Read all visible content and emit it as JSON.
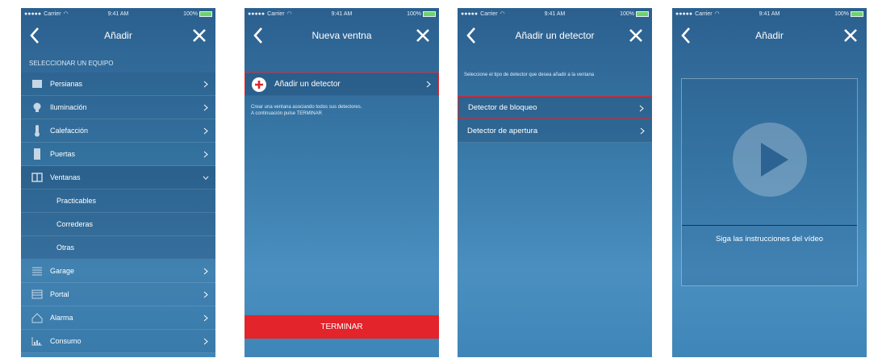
{
  "status": {
    "carrier": "Carrier",
    "time": "9:41 AM",
    "battery": "100%"
  },
  "screen1": {
    "title": "Añadir",
    "section_label": "SELECCIONAR UN EQUIPO",
    "items": [
      {
        "label": "Persianas",
        "icon": "blinds-icon"
      },
      {
        "label": "Iluminación",
        "icon": "bulb-icon"
      },
      {
        "label": "Calefacción",
        "icon": "thermometer-icon"
      },
      {
        "label": "Puertas",
        "icon": "door-icon"
      },
      {
        "label": "Ventanas",
        "icon": "window-icon",
        "expanded": true
      },
      {
        "label": "Practicables",
        "sub": true
      },
      {
        "label": "Correderas",
        "sub": true
      },
      {
        "label": "Otras",
        "sub": true
      },
      {
        "label": "Garage",
        "icon": "garage-icon"
      },
      {
        "label": "Portal",
        "icon": "gate-icon"
      },
      {
        "label": "Alarma",
        "icon": "home-icon"
      },
      {
        "label": "Consumo",
        "icon": "chart-icon"
      }
    ]
  },
  "screen2": {
    "title": "Nueva ventna",
    "add_label": "Añadir un detector",
    "help_line1": "Crear una ventana asociando todos sus detectores.",
    "help_line2": "A continuación pulse TERMINAR",
    "finish_label": "TERMINAR"
  },
  "screen3": {
    "title": "Añadir un detector",
    "instruction": "Seleccione el tipo de detector que desea añadir a la ventana",
    "options": [
      "Detector de bloqueo",
      "Detector de apertura"
    ]
  },
  "screen4": {
    "title": "Añadir",
    "caption": "Siga las instrucciones del vídeo"
  },
  "colors": {
    "accent": "#e3242b",
    "bg_top": "#2b5f8e",
    "bg_mid": "#3a7cab"
  }
}
